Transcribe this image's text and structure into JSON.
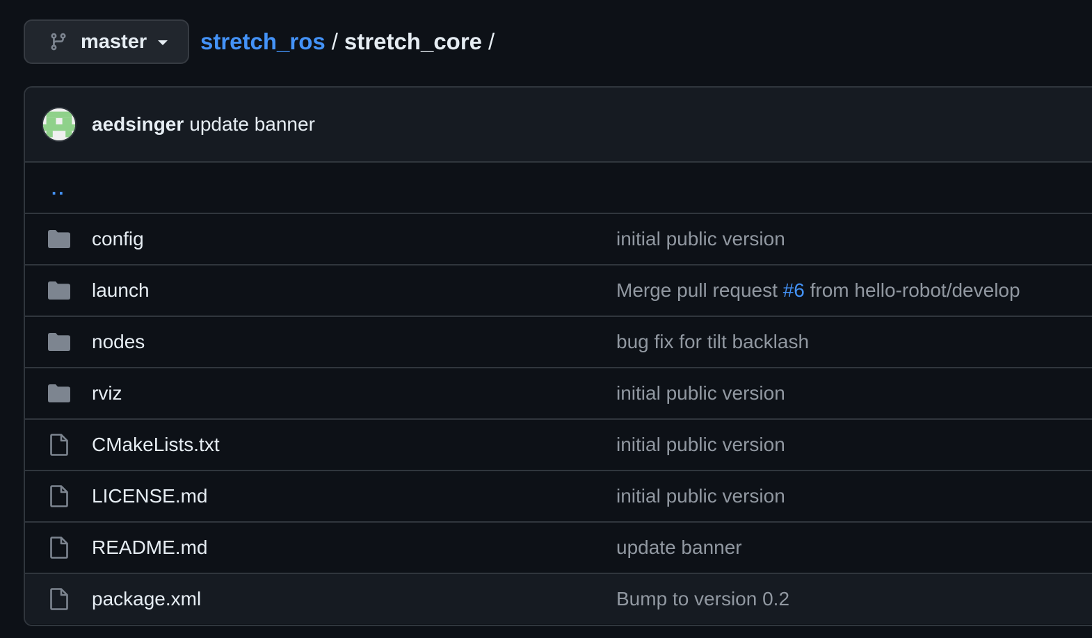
{
  "branch": {
    "name": "master",
    "icon": "git-branch-icon",
    "caret_icon": "caret-down-icon"
  },
  "breadcrumb": {
    "repo": "stretch_ros",
    "separator": "/",
    "current": "stretch_core",
    "trailing": "/"
  },
  "commit": {
    "author": "aedsinger",
    "message": "update banner",
    "avatar_icon": "avatar-identicon"
  },
  "parent_dir": {
    "label": ".."
  },
  "files": [
    {
      "type": "dir",
      "icon": "folder-icon",
      "name": "config",
      "message": "initial public version"
    },
    {
      "type": "dir",
      "icon": "folder-icon",
      "name": "launch",
      "message_prefix": "Merge pull request ",
      "pr_number": "#6",
      "message_suffix": " from hello-robot/develop"
    },
    {
      "type": "dir",
      "icon": "folder-icon",
      "name": "nodes",
      "message": "bug fix for tilt backlash"
    },
    {
      "type": "dir",
      "icon": "folder-icon",
      "name": "rviz",
      "message": "initial public version"
    },
    {
      "type": "file",
      "icon": "file-icon",
      "name": "CMakeLists.txt",
      "message": "initial public version"
    },
    {
      "type": "file",
      "icon": "file-icon",
      "name": "LICENSE.md",
      "message": "initial public version"
    },
    {
      "type": "file",
      "icon": "file-icon",
      "name": "README.md",
      "message": "update banner"
    },
    {
      "type": "file",
      "icon": "file-icon",
      "name": "package.xml",
      "message": "Bump to version 0.2"
    }
  ],
  "colors": {
    "background": "#0d1117",
    "link": "#4493f8",
    "muted_text": "#9198a1",
    "border": "#30363d",
    "icon_gray": "#7d8590",
    "avatar_green": "#8fd18a"
  }
}
